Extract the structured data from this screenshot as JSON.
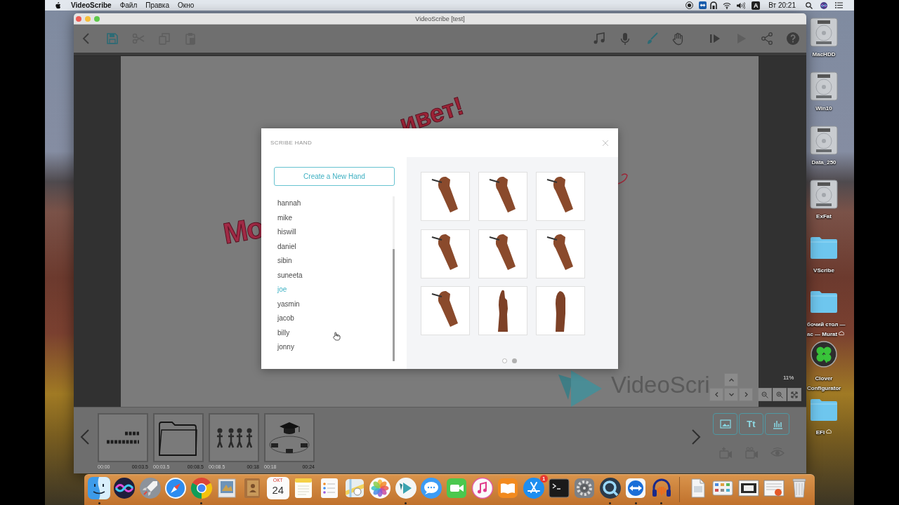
{
  "menu_bar": {
    "app_name": "VideoScribe",
    "menus": [
      "Файл",
      "Правка",
      "Окно"
    ],
    "input_source": "A",
    "clock": "Вт 20:21"
  },
  "window": {
    "title": "VideoScribe [test]",
    "toolbar": {
      "edit_tools": [
        {
          "kind": "back",
          "disabled": false,
          "highlighted": false
        },
        {
          "kind": "save",
          "disabled": false,
          "highlighted": true
        },
        {
          "kind": "cut",
          "disabled": true,
          "highlighted": false
        },
        {
          "kind": "copy",
          "disabled": true,
          "highlighted": false
        },
        {
          "kind": "paste",
          "disabled": true,
          "highlighted": false
        }
      ],
      "media_tools": [
        {
          "kind": "music",
          "disabled": false,
          "highlighted": false
        },
        {
          "kind": "microphone",
          "disabled": false,
          "highlighted": false
        },
        {
          "kind": "brush",
          "disabled": false,
          "highlighted": true
        },
        {
          "kind": "hand",
          "disabled": false,
          "highlighted": false
        }
      ],
      "play_tools": [
        {
          "kind": "play_from",
          "disabled": false,
          "highlighted": false
        },
        {
          "kind": "play",
          "disabled": true,
          "highlighted": false
        },
        {
          "kind": "share",
          "disabled": false,
          "highlighted": false
        },
        {
          "kind": "help",
          "disabled": false,
          "highlighted": false
        }
      ]
    },
    "canvas": {
      "texts": [
        "ивет!",
        "Мо"
      ],
      "logo_text": "VideoScri",
      "zoom": "11%"
    },
    "timeline": {
      "scenes": [
        {
          "kind": "text",
          "start": "00:00",
          "end": "00:03.5"
        },
        {
          "kind": "folder",
          "start": "00:03.5",
          "end": "00:08.5"
        },
        {
          "kind": "people",
          "start": "00:08.5",
          "end": "00:18"
        },
        {
          "kind": "graduation",
          "start": "00:18",
          "end": "00:24"
        }
      ],
      "tools": [
        {
          "kind": "image"
        },
        {
          "kind": "text",
          "label": "Tt"
        },
        {
          "kind": "chart"
        }
      ],
      "scene_tools": [
        {
          "kind": "camera_add"
        },
        {
          "kind": "camera"
        },
        {
          "kind": "eye"
        }
      ]
    }
  },
  "dialog": {
    "title": "SCRIBE HAND",
    "create_button": "Create a New Hand",
    "hands": [
      {
        "name": "hannah",
        "selected": false
      },
      {
        "name": "mike",
        "selected": false
      },
      {
        "name": "hiswill",
        "selected": false
      },
      {
        "name": "daniel",
        "selected": false
      },
      {
        "name": "sibin",
        "selected": false
      },
      {
        "name": "suneeta",
        "selected": false
      },
      {
        "name": "joe",
        "selected": true
      },
      {
        "name": "yasmin",
        "selected": false
      },
      {
        "name": "jacob",
        "selected": false
      },
      {
        "name": "billy",
        "selected": false
      },
      {
        "name": "jonny",
        "selected": false
      }
    ],
    "images": [
      {
        "kind": "writing"
      },
      {
        "kind": "writing"
      },
      {
        "kind": "writing"
      },
      {
        "kind": "writing"
      },
      {
        "kind": "writing"
      },
      {
        "kind": "writing"
      },
      {
        "kind": "writing"
      },
      {
        "kind": "pointing"
      },
      {
        "kind": "palm"
      }
    ],
    "pages": [
      {
        "selected": false
      },
      {
        "selected": true
      }
    ]
  },
  "desktop_icons": [
    {
      "kind": "drive",
      "label": [
        "MacHDD"
      ],
      "cloud": false
    },
    {
      "kind": "drive",
      "label": [
        "Win10"
      ],
      "cloud": false
    },
    {
      "kind": "drive",
      "label": [
        "Data_250"
      ],
      "cloud": false
    },
    {
      "kind": "drive",
      "label": [
        "ExFat"
      ],
      "cloud": false
    },
    {
      "kind": "folder",
      "label": [
        "VScribe"
      ],
      "cloud": false
    },
    {
      "kind": "folder",
      "label": [
        "бочий стол —",
        "ас — Murat"
      ],
      "cloud": true
    },
    {
      "kind": "app",
      "label": [
        "Clover",
        "Configurator"
      ],
      "cloud": false
    },
    {
      "kind": "folder",
      "label": [
        "EFI"
      ],
      "cloud": true
    }
  ],
  "dock": {
    "apps": [
      {
        "kind": "finder",
        "running": true
      },
      {
        "kind": "orb",
        "running": false
      },
      {
        "kind": "rocket",
        "running": false
      },
      {
        "kind": "compass",
        "running": false
      },
      {
        "kind": "tricolor",
        "running": true
      },
      {
        "kind": "preview",
        "running": false
      },
      {
        "kind": "contacts",
        "running": false
      },
      {
        "kind": "calendar",
        "running": false,
        "month": "ОКТ",
        "day": "24"
      },
      {
        "kind": "notes",
        "running": false
      },
      {
        "kind": "reminders",
        "running": false
      },
      {
        "kind": "maps",
        "running": false
      },
      {
        "kind": "photos",
        "running": false
      },
      {
        "kind": "videoscribe",
        "running": true
      },
      {
        "kind": "messages",
        "running": false
      },
      {
        "kind": "facetime",
        "running": false
      },
      {
        "kind": "music",
        "running": false
      },
      {
        "kind": "books",
        "running": false
      },
      {
        "kind": "store",
        "running": false,
        "badge": "1"
      },
      {
        "kind": "terminal",
        "running": false
      },
      {
        "kind": "settings",
        "running": false
      },
      {
        "kind": "lens",
        "running": true
      },
      {
        "kind": "remote",
        "running": true
      },
      {
        "kind": "audio",
        "running": true
      }
    ],
    "stacks": [
      {
        "kind": "document"
      },
      {
        "kind": "grid"
      },
      {
        "kind": "screen"
      },
      {
        "kind": "sheet"
      },
      {
        "kind": "trash"
      }
    ]
  }
}
